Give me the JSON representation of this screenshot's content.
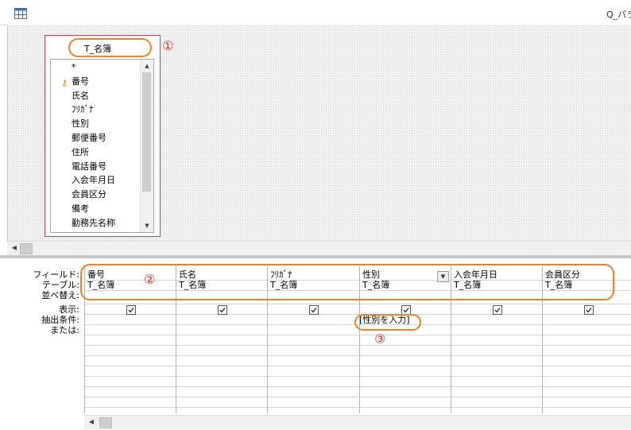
{
  "window": {
    "title": "Q_パラ"
  },
  "table": {
    "name": "T_名簿",
    "fields": [
      "*",
      "番号",
      "氏名",
      "ﾌﾘｶﾞﾅ",
      "性別",
      "郵便番号",
      "住所",
      "電話番号",
      "入会年月日",
      "会員区分",
      "備考",
      "勤務先名称"
    ],
    "primary_key_field": "番号"
  },
  "grid": {
    "row_labels": [
      "フィールド:",
      "テーブル:",
      "並べ替え:",
      "表示:",
      "抽出条件:",
      "または:"
    ],
    "columns": [
      {
        "field": "番号",
        "table": "T_名簿",
        "show": true,
        "criteria": ""
      },
      {
        "field": "氏名",
        "table": "T_名簿",
        "show": true,
        "criteria": ""
      },
      {
        "field": "ﾌﾘｶﾞﾅ",
        "table": "T_名簿",
        "show": true,
        "criteria": ""
      },
      {
        "field": "性別",
        "table": "T_名簿",
        "show": true,
        "criteria": "[性別を入力]"
      },
      {
        "field": "入会年月日",
        "table": "T_名簿",
        "show": true,
        "criteria": ""
      },
      {
        "field": "会員区分",
        "table": "T_名簿",
        "show": true,
        "criteria": ""
      }
    ]
  },
  "annotations": [
    "①",
    "②",
    "③"
  ],
  "colors": {
    "annotation_oval": "#f08020",
    "annotation_number": "#e03020",
    "table_border": "#b8444a",
    "key_icon": "#c79b00"
  }
}
